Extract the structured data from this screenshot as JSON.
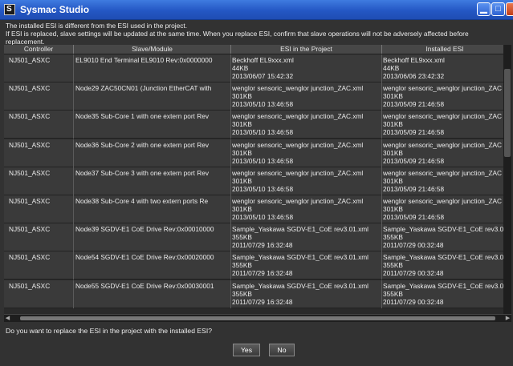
{
  "window": {
    "title": "Sysmac Studio",
    "controls": {
      "minimize": "▁",
      "maximize": "□",
      "close": "×"
    }
  },
  "message": {
    "line1": "The installed ESI is different from the ESI used in the project.",
    "line2": "If ESI is replaced, slave settings will be updated at the same time. When you replace ESI, confirm that slave operations will not be adversely affected before",
    "line3": "replacement."
  },
  "table": {
    "headers": [
      "Controller",
      "Slave/Module",
      "ESI in the Project",
      "Installed ESI"
    ],
    "rows": [
      {
        "controller": "NJ501_ASXC",
        "slave": "EL9010 End Terminal EL9010 Rev:0x0000000",
        "project": {
          "file": "Beckhoff EL9xxx.xml",
          "size": "44KB",
          "date": "2013/06/07 15:42:32"
        },
        "installed": {
          "file": "Beckhoff EL9xxx.xml",
          "size": "44KB",
          "date": "2013/06/06 23:42:32"
        }
      },
      {
        "controller": "NJ501_ASXC",
        "slave": "Node29 ZAC50CN01 (Junction EtherCAT with",
        "project": {
          "file": "wenglor sensoric_wenglor junction_ZAC.xml",
          "size": "301KB",
          "date": "2013/05/10 13:46:58"
        },
        "installed": {
          "file": "wenglor sensoric_wenglor junction_ZAC",
          "size": "301KB",
          "date": "2013/05/09 21:46:58"
        }
      },
      {
        "controller": "NJ501_ASXC",
        "slave": "Node35 Sub-Core 1 with one extern port Rev",
        "project": {
          "file": "wenglor sensoric_wenglor junction_ZAC.xml",
          "size": "301KB",
          "date": "2013/05/10 13:46:58"
        },
        "installed": {
          "file": "wenglor sensoric_wenglor junction_ZAC",
          "size": "301KB",
          "date": "2013/05/09 21:46:58"
        }
      },
      {
        "controller": "NJ501_ASXC",
        "slave": "Node36 Sub-Core 2 with one extern port Rev",
        "project": {
          "file": "wenglor sensoric_wenglor junction_ZAC.xml",
          "size": "301KB",
          "date": "2013/05/10 13:46:58"
        },
        "installed": {
          "file": "wenglor sensoric_wenglor junction_ZAC",
          "size": "301KB",
          "date": "2013/05/09 21:46:58"
        }
      },
      {
        "controller": "NJ501_ASXC",
        "slave": "Node37 Sub-Core 3 with one extern port Rev",
        "project": {
          "file": "wenglor sensoric_wenglor junction_ZAC.xml",
          "size": "301KB",
          "date": "2013/05/10 13:46:58"
        },
        "installed": {
          "file": "wenglor sensoric_wenglor junction_ZAC",
          "size": "301KB",
          "date": "2013/05/09 21:46:58"
        }
      },
      {
        "controller": "NJ501_ASXC",
        "slave": "Node38 Sub-Core 4 with two extern ports Re",
        "project": {
          "file": "wenglor sensoric_wenglor junction_ZAC.xml",
          "size": "301KB",
          "date": "2013/05/10 13:46:58"
        },
        "installed": {
          "file": "wenglor sensoric_wenglor junction_ZAC",
          "size": "301KB",
          "date": "2013/05/09 21:46:58"
        }
      },
      {
        "controller": "NJ501_ASXC",
        "slave": "Node39 SGDV-E1 CoE Drive Rev:0x00010000",
        "project": {
          "file": "Sample_Yaskawa SGDV-E1_CoE rev3.01.xml",
          "size": "355KB",
          "date": "2011/07/29 16:32:48"
        },
        "installed": {
          "file": "Sample_Yaskawa SGDV-E1_CoE rev3.0",
          "size": "355KB",
          "date": "2011/07/29 00:32:48"
        }
      },
      {
        "controller": "NJ501_ASXC",
        "slave": "Node54 SGDV-E1 CoE Drive Rev:0x00020000",
        "project": {
          "file": "Sample_Yaskawa SGDV-E1_CoE rev3.01.xml",
          "size": "355KB",
          "date": "2011/07/29 16:32:48"
        },
        "installed": {
          "file": "Sample_Yaskawa SGDV-E1_CoE rev3.0",
          "size": "355KB",
          "date": "2011/07/29 00:32:48"
        }
      },
      {
        "controller": "NJ501_ASXC",
        "slave": "Node55 SGDV-E1 CoE Drive Rev:0x00030001",
        "project": {
          "file": "Sample_Yaskawa SGDV-E1_CoE rev3.01.xml",
          "size": "355KB",
          "date": "2011/07/29 16:32:48"
        },
        "installed": {
          "file": "Sample_Yaskawa SGDV-E1_CoE rev3.0",
          "size": "355KB",
          "date": "2011/07/29 00:32:48"
        }
      }
    ]
  },
  "question": "Do you want to replace the ESI in the project with the installed ESI?",
  "buttons": {
    "yes": "Yes",
    "no": "No"
  }
}
